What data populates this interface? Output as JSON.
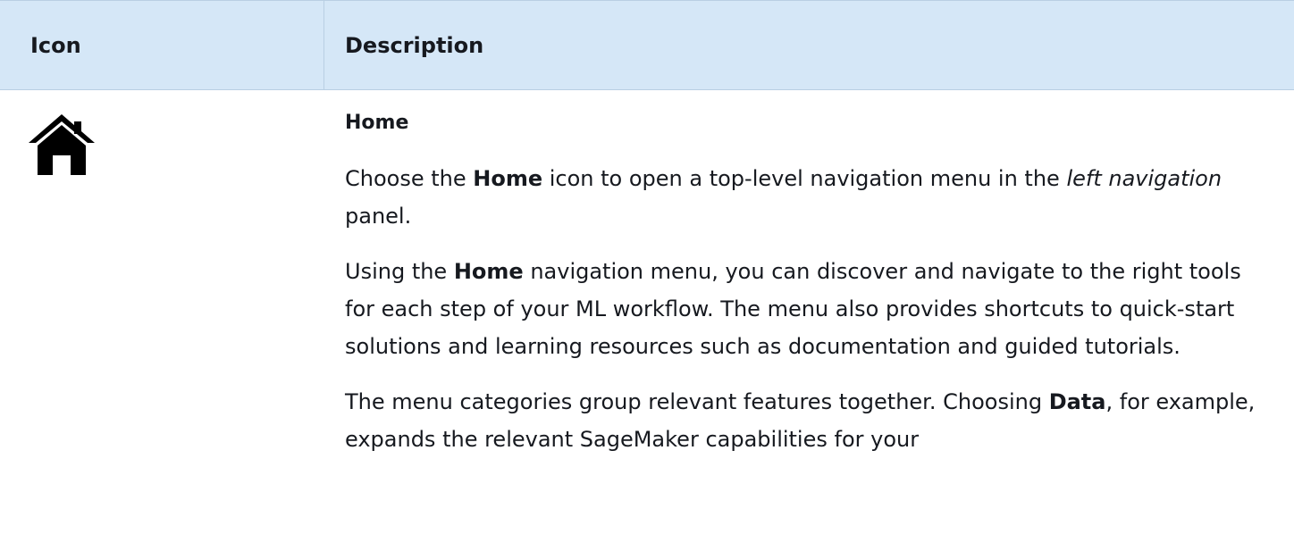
{
  "table": {
    "headers": {
      "icon": "Icon",
      "description": "Description"
    },
    "rows": [
      {
        "icon_name": "home-icon",
        "title": "Home",
        "paragraph1": {
          "part1": "Choose the ",
          "bold1": "Home",
          "part2": " icon to open a top-level navigation menu in the ",
          "italic1": "left navigation",
          "part3": " panel."
        },
        "paragraph2": {
          "part1": "Using the ",
          "bold1": "Home",
          "part2": " navigation menu, you can discover and navigate to the right tools for each step of your ML workflow. The menu also provides shortcuts to quick-start solutions and learning resources such as documentation and guided tutorials."
        },
        "paragraph3": {
          "part1": "The menu categories group relevant features together. Choosing ",
          "bold1": "Data",
          "part2": ", for example, expands the relevant SageMaker capabilities for your"
        }
      }
    ]
  },
  "colors": {
    "header_background": "#d5e7f7",
    "text": "#16191f"
  }
}
